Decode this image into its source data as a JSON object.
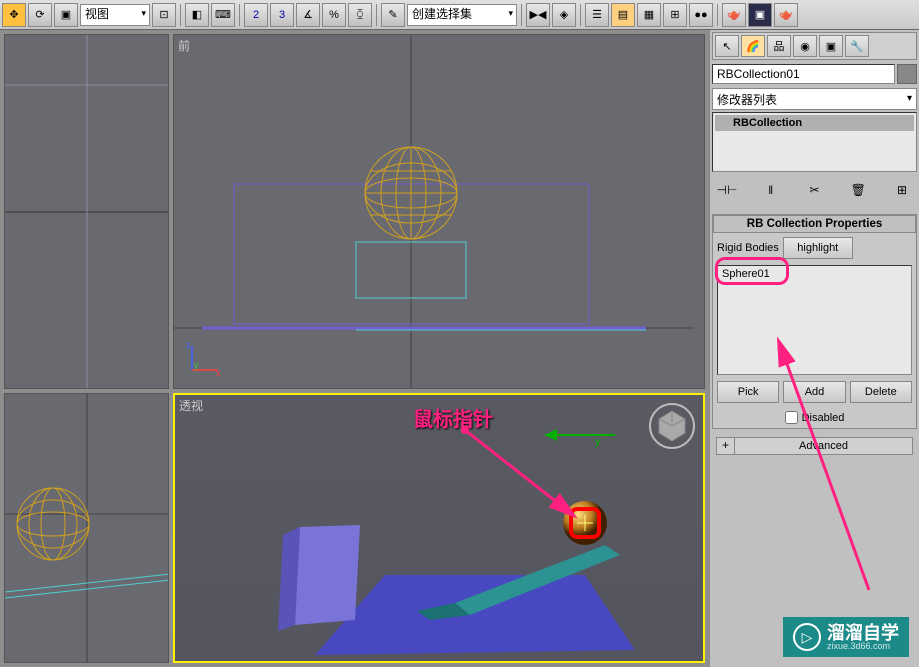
{
  "toolbar": {
    "view_select": "视图",
    "selection_select": "创建选择集"
  },
  "viewports": {
    "top_right_label": "前",
    "bottom_right_label": "透视"
  },
  "panel": {
    "object_name": "RBCollection01",
    "modifier_dropdown": "修改器列表",
    "modifier_stack_item": "RBCollection",
    "rollout1_title": "RB Collection Properties",
    "rigid_bodies_label": "Rigid Bodies",
    "highlight_btn": "highlight",
    "list_item": "Sphere01",
    "pick_btn": "Pick",
    "add_btn": "Add",
    "delete_btn": "Delete",
    "disabled_check": "Disabled",
    "advanced_label": "Advanced",
    "advanced_plus": "+"
  },
  "annotation": {
    "pointer_label": "鼠标指针"
  },
  "watermark": {
    "title": "溜溜自学",
    "url": "zixue.3d66.com"
  },
  "axis": {
    "x": "x",
    "y": "y",
    "z": "z"
  }
}
